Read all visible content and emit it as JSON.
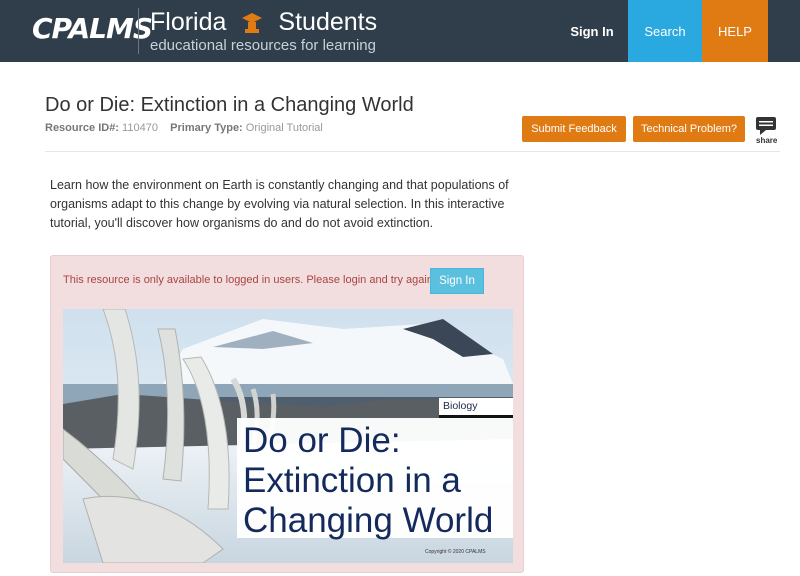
{
  "header": {
    "logo_text": "CPALMS",
    "brand_title": "Florida",
    "brand_audience": "Students",
    "brand_subtitle": "educational resources for learning",
    "nav": {
      "sign_in": "Sign In",
      "search": "Search",
      "help": "HELP"
    },
    "colors": {
      "bar": "#2f3e4a",
      "search": "#29a9e0",
      "help": "#e07b14"
    }
  },
  "resource": {
    "title": "Do or Die: Extinction in a Changing World",
    "id_label": "Resource ID#:",
    "id_value": "110470",
    "type_label": "Primary Type:",
    "type_value": "Original Tutorial",
    "feedback_button": "Submit Feedback",
    "technical_button": "Technical Problem?",
    "share_label": "share",
    "description": "Learn how the environment on Earth is constantly changing and that populations of organisms adapt to this change by evolving via natural selection. In this interactive tutorial, you'll discover how organisms do and do not avoid extinction."
  },
  "alert": {
    "message": "This resource is only available to logged in users. Please login and try again.",
    "sign_in": "Sign In"
  },
  "hero": {
    "subject": "Biology",
    "title": "Do or Die: Extinction in a Changing World",
    "copyright": "Copyright © 2020 CPALMS"
  }
}
